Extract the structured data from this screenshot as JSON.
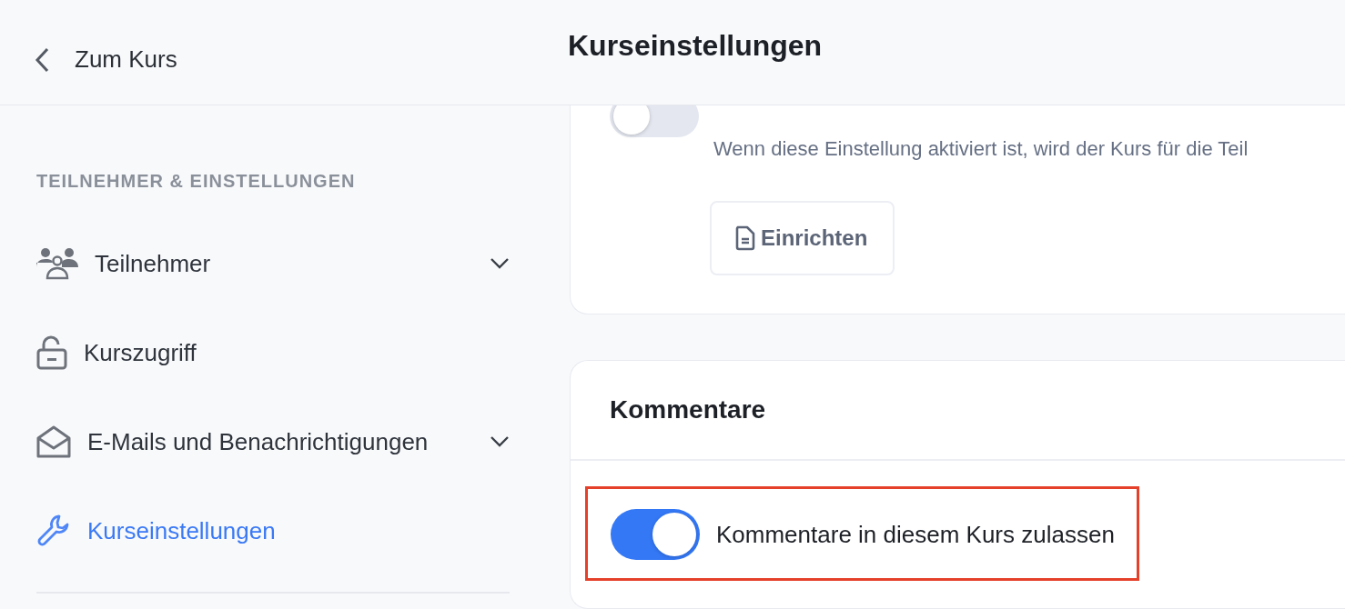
{
  "header": {
    "back_label": "Zum Kurs",
    "title": "Kurseinstellungen"
  },
  "sidebar": {
    "section_label": "TEILNEHMER & EINSTELLUNGEN",
    "items": [
      {
        "label": "Teilnehmer",
        "kind": "people",
        "selected": false,
        "expandable": true
      },
      {
        "label": "Kurszugriff",
        "kind": "lock",
        "selected": false,
        "expandable": false
      },
      {
        "label": "E-Mails und Benachrichtigungen",
        "kind": "mail",
        "selected": false,
        "expandable": true
      },
      {
        "label": "Kurseinstellungen",
        "kind": "wrench",
        "selected": true,
        "expandable": false
      }
    ]
  },
  "cards": [
    {
      "toggle_on": false,
      "description": "Wenn diese Einstellung aktiviert ist, wird der Kurs für die Teil",
      "button": "Einrichten"
    },
    {
      "title": "Kommentare",
      "setting": {
        "label": "Kommentare in diesem Kurs zulassen",
        "on": true,
        "highlighted": true
      }
    }
  ]
}
